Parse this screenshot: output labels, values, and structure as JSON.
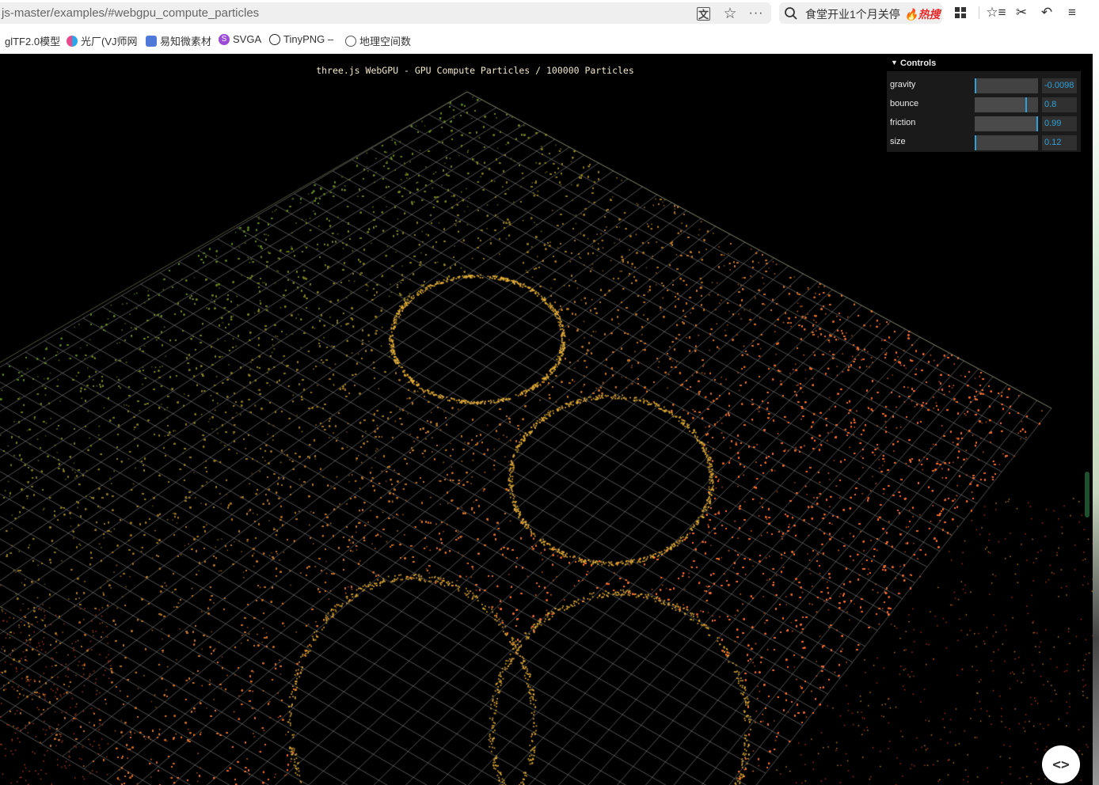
{
  "browser": {
    "url": "js-master/examples/#webgpu_compute_particles",
    "search_text": "食堂开业1个月关停",
    "hot_label": "热搜",
    "bookmarks": [
      {
        "label": "glTF2.0模型",
        "icon": "gltf-icon"
      },
      {
        "label": "光厂(VJ师网",
        "icon": "guangchang-icon"
      },
      {
        "label": "易知微素材",
        "icon": "yizhiwei-icon"
      },
      {
        "label": "SVGA",
        "icon": "svga-icon"
      },
      {
        "label": "TinyPNG –",
        "icon": "panda-icon"
      },
      {
        "label": "地理空间数",
        "icon": "globe-icon"
      }
    ]
  },
  "scene": {
    "info": "three.js WebGPU - GPU Compute Particles / 100000 Particles",
    "colors": {
      "particle_green": "#3d8a2a",
      "particle_orange": "#d49a2c",
      "particle_red": "#c43a1e",
      "grid": "#7a7a7a"
    }
  },
  "controls": {
    "title": "Controls",
    "rows": [
      {
        "label": "gravity",
        "value": "-0.0098",
        "fraction": 0.0
      },
      {
        "label": "bounce",
        "value": "0.8",
        "fraction": 0.8
      },
      {
        "label": "friction",
        "value": "0.99",
        "fraction": 0.99
      },
      {
        "label": "size",
        "value": "0.12",
        "fraction": 0.0
      }
    ]
  },
  "code_button": "<>"
}
